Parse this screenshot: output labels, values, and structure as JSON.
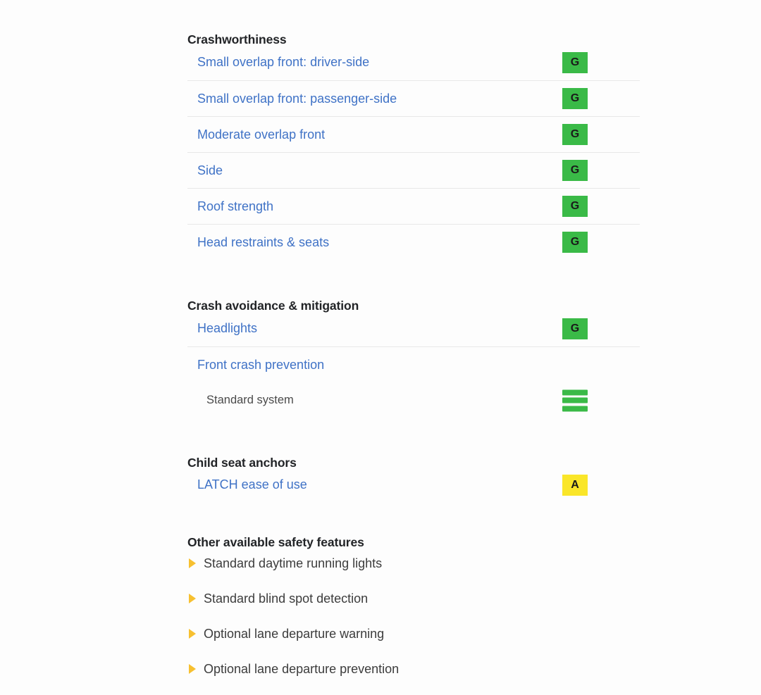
{
  "colors": {
    "good_green": "#3aba47",
    "acceptable_yellow": "#fae629",
    "link_blue": "#3f72c6",
    "heading_dark": "#222427",
    "bullet_amber": "#f7c030",
    "divider": "#e8e8e8",
    "page_background": "#fdfdfd"
  },
  "sections": {
    "crashworthiness": {
      "heading": "Crashworthiness",
      "rows": [
        {
          "label": "Small overlap front: driver-side",
          "rating": "G",
          "rating_type": "grade-g",
          "divider": false
        },
        {
          "label": "Small overlap front: passenger-side",
          "rating": "G",
          "rating_type": "grade-g",
          "divider": true
        },
        {
          "label": "Moderate overlap front",
          "rating": "G",
          "rating_type": "grade-g",
          "divider": true
        },
        {
          "label": "Side",
          "rating": "G",
          "rating_type": "grade-g",
          "divider": true
        },
        {
          "label": "Roof strength",
          "rating": "G",
          "rating_type": "grade-g",
          "divider": true
        },
        {
          "label": "Head restraints & seats",
          "rating": "G",
          "rating_type": "grade-g",
          "divider": true
        }
      ]
    },
    "crash_avoidance": {
      "heading": "Crash avoidance & mitigation",
      "rows": [
        {
          "label": "Headlights",
          "rating": "G",
          "rating_type": "grade-g",
          "divider": false
        },
        {
          "label": "Front crash prevention",
          "rating": "",
          "rating_type": "none",
          "divider": true
        },
        {
          "label": "Standard system",
          "rating": "",
          "rating_type": "bars",
          "divider": false,
          "sub": true
        }
      ]
    },
    "child_seat_anchors": {
      "heading": "Child seat anchors",
      "rows": [
        {
          "label": "LATCH ease of use",
          "rating": "A",
          "rating_type": "grade-a",
          "divider": false
        }
      ]
    },
    "other_features": {
      "heading": "Other available safety features",
      "items": [
        {
          "label": "Standard daytime running lights",
          "bullet": "triangle-right-icon"
        },
        {
          "label": "Standard blind spot detection",
          "bullet": "triangle-right-icon"
        },
        {
          "label": "Optional lane departure warning",
          "bullet": "triangle-right-icon"
        },
        {
          "label": "Optional lane departure prevention",
          "bullet": "triangle-right-icon"
        }
      ]
    }
  }
}
